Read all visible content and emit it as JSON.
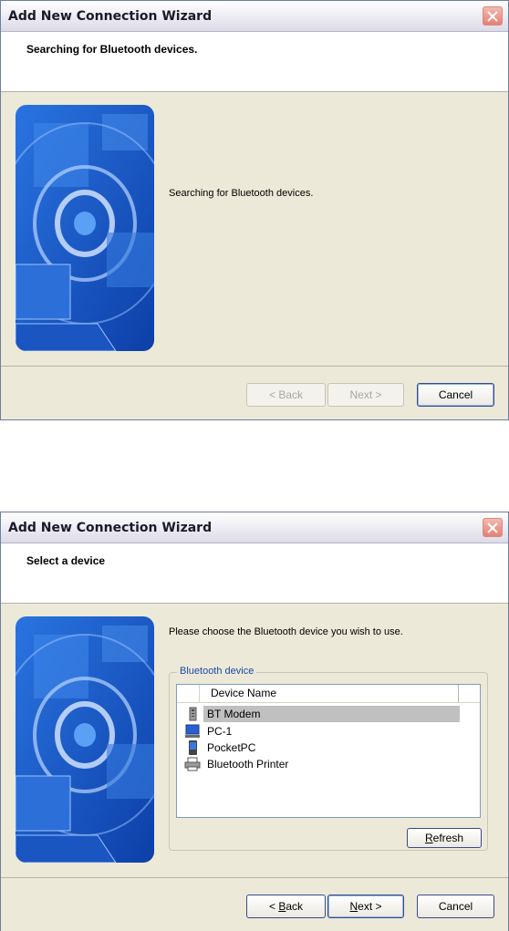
{
  "dialogs": [
    {
      "title": "Add New Connection Wizard",
      "header_title": "Searching for Bluetooth devices.",
      "body_text": "Searching for Bluetooth devices.",
      "buttons": {
        "back": "< Back",
        "next": "Next >",
        "cancel": "Cancel"
      },
      "back_enabled": false,
      "next_enabled": false
    },
    {
      "title": "Add New Connection Wizard",
      "header_title": "Select a device",
      "body_text": "Please choose the Bluetooth device you wish to use.",
      "group_label": "Bluetooth device",
      "column_header": "Device Name",
      "devices": [
        {
          "name": "BT Modem",
          "icon": "modem-icon",
          "selected": true
        },
        {
          "name": "PC-1",
          "icon": "computer-icon",
          "selected": false
        },
        {
          "name": "PocketPC",
          "icon": "pda-icon",
          "selected": false
        },
        {
          "name": "Bluetooth Printer",
          "icon": "printer-icon",
          "selected": false
        }
      ],
      "refresh_pre": "",
      "refresh_ul": "R",
      "refresh_post": "efresh",
      "back_pre": "< ",
      "back_ul": "B",
      "back_post": "ack",
      "next_ul": "N",
      "next_post": "ext >",
      "cancel": "Cancel",
      "back_enabled": true,
      "next_enabled": true
    }
  ],
  "colors": {
    "accent_blue": "#1a4aa8",
    "art_blue": "#1f5fd1",
    "selection": "#c0c0c0"
  }
}
